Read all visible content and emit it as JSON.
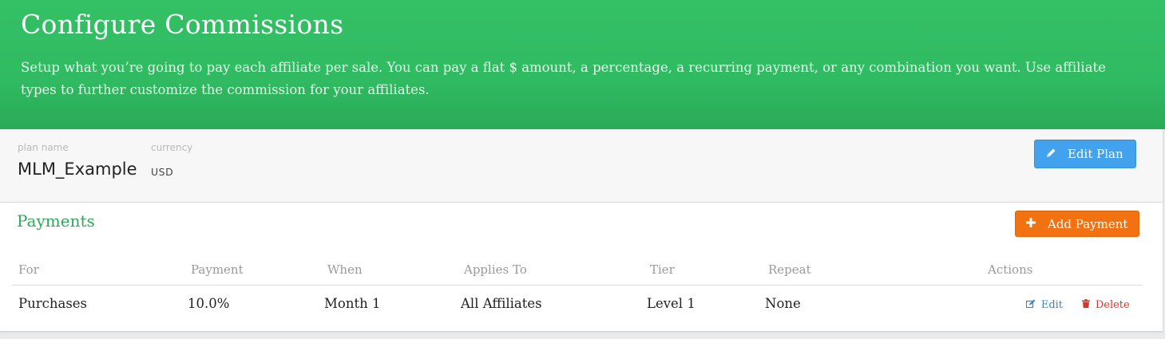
{
  "header": {
    "title": "Configure Commissions",
    "description": "Setup what you’re going to pay each affiliate per sale. You can pay a flat $ amount, a percentage, a recurring payment, or any combination you want. Use affiliate types to further customize the commission for your affiliates."
  },
  "plan": {
    "name_label": "plan name",
    "name_value": "MLM_Example",
    "currency_label": "currency",
    "currency_value": "USD",
    "edit_button": {
      "label": "Edit Plan",
      "icon": "pencil-icon",
      "color": "#43a2ee"
    }
  },
  "payments": {
    "title": "Payments",
    "add_button": {
      "label": "Add Payment",
      "icon": "plus-icon",
      "color": "#f27212"
    },
    "columns": [
      "For",
      "Payment",
      "When",
      "Applies To",
      "Tier",
      "Repeat",
      "Actions"
    ],
    "rows": [
      {
        "for": "Purchases",
        "payment": "10.0%",
        "when": "Month 1",
        "applies_to": "All Affiliates",
        "tier": "Level 1",
        "repeat": "None",
        "actions": {
          "edit": {
            "label": "Edit",
            "icon": "edit-icon",
            "color": "#3a83c7"
          },
          "delete": {
            "label": "Delete",
            "icon": "trash-icon",
            "color": "#d0392b"
          }
        }
      }
    ]
  },
  "colors": {
    "header_green": "#30bb62",
    "section_title_green": "#2ea85a"
  }
}
